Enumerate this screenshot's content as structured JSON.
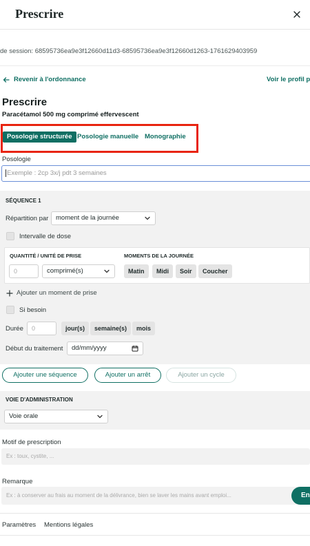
{
  "header": {
    "title": "Prescrire",
    "close_icon": "close-icon"
  },
  "session": {
    "text": "de session: 68595736ea9e3f12660d11d3-68595736ea9e3f12660d1263-1761629403959"
  },
  "nav": {
    "back_label": "Revenir à l'ordonnance",
    "profile_label": "Voir le profil pa"
  },
  "prescription": {
    "title": "Prescrire",
    "drug": "Paracétamol 500 mg comprimé effervescent"
  },
  "tabs": [
    {
      "label": "Posologie structurée",
      "active": true
    },
    {
      "label": "Posologie manuelle",
      "active": false
    },
    {
      "label": "Monographie",
      "active": false
    }
  ],
  "posologie": {
    "label": "Posologie",
    "placeholder": "Exemple : 2cp 3x/j pdt 3 semaines"
  },
  "sequence": {
    "title": "SÉQUENCE 1",
    "repartition_label": "Répartition par",
    "repartition_value": "moment de la journée",
    "interval_label": "Intervalle de dose",
    "qty_caption": "QUANTITÉ / UNITÉ DE PRISE",
    "qty_placeholder": "0",
    "unit_value": "comprimé(s)",
    "moments_caption": "MOMENTS DE LA JOURNÉE",
    "moments": [
      "Matin",
      "Midi",
      "Soir",
      "Coucher"
    ],
    "add_moment_label": "Ajouter un moment de prise",
    "si_besoin_label": "Si besoin",
    "duree_label": "Durée",
    "duree_placeholder": "0",
    "duree_units": [
      "jour(s)",
      "semaine(s)",
      "mois"
    ],
    "debut_label": "Début du traitement",
    "debut_placeholder": "dd/mm/yyyy"
  },
  "actions": {
    "add_sequence": "Ajouter une séquence",
    "add_stop": "Ajouter un arrêt",
    "add_cycle": "Ajouter un cycle"
  },
  "voie": {
    "title": "VOIE D'ADMINISTRATION",
    "value": "Voie orale"
  },
  "motif": {
    "label": "Motif de prescription",
    "placeholder": "Ex : toux, cystite, ..."
  },
  "remarque": {
    "label": "Remarque",
    "placeholder": "Ex : à conserver au frais au moment de la délivrance, bien se laver les mains avant emploi...",
    "send_label": "En"
  },
  "footer": {
    "links": [
      "Paramètres",
      "Mentions légales"
    ]
  },
  "colors": {
    "accent": "#0f6f63",
    "highlight": "#e8240f",
    "input_focus": "#6a8fd8"
  }
}
